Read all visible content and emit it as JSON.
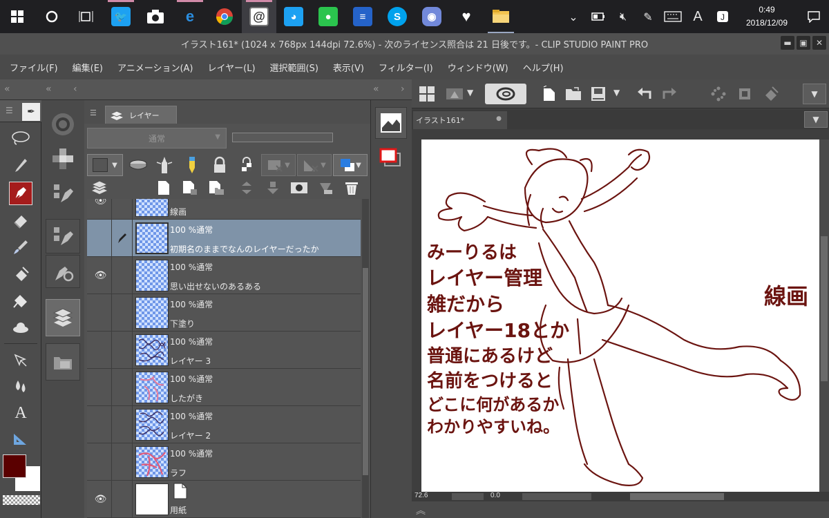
{
  "taskbar": {
    "apps": [
      "start",
      "search-circle",
      "task-view",
      "twitter",
      "camera",
      "edge",
      "chrome",
      "clip-studio",
      "cat-app",
      "line",
      "file-stack",
      "skype",
      "discord",
      "heart-app",
      "file-explorer"
    ],
    "tray": {
      "ime": "A",
      "time": "0:49",
      "date": "2018/12/09"
    }
  },
  "window": {
    "title": "イラスト161* (1024 x 768px 144dpi 72.6%)  - 次のライセンス照合は 21 日後です。- CLIP STUDIO PAINT PRO"
  },
  "menu": [
    "ファイル(F)",
    "編集(E)",
    "アニメーション(A)",
    "レイヤー(L)",
    "選択範囲(S)",
    "表示(V)",
    "フィルター(I)",
    "ウィンドウ(W)",
    "ヘルプ(H)"
  ],
  "layer_panel": {
    "tab_label": "レイヤー",
    "blend_mode": "通常",
    "layers": [
      {
        "name": "線画",
        "blend": "",
        "visible": true,
        "selected": false,
        "thumb": "lines",
        "partial": true
      },
      {
        "name": "初期名のままでなんのレイヤーだったか",
        "blend": "100 %通常",
        "visible": false,
        "selected": true,
        "thumb": "empty",
        "pen": true
      },
      {
        "name": "思い出せないのあるある",
        "blend": "100 %通常",
        "visible": true,
        "selected": false,
        "thumb": "empty"
      },
      {
        "name": "下塗り",
        "blend": "100 %通常",
        "visible": false,
        "selected": false,
        "thumb": "empty"
      },
      {
        "name": "レイヤー 3",
        "blend": "100 %通常",
        "visible": false,
        "selected": false,
        "thumb": "scribble"
      },
      {
        "name": "したがき",
        "blend": "100 %通常",
        "visible": false,
        "selected": false,
        "thumb": "pink"
      },
      {
        "name": "レイヤー 2",
        "blend": "100 %通常",
        "visible": false,
        "selected": false,
        "thumb": "scribble"
      },
      {
        "name": "ラフ",
        "blend": "100 %通常",
        "visible": false,
        "selected": false,
        "thumb": "pink"
      },
      {
        "name": "用紙",
        "blend": "",
        "visible": true,
        "selected": false,
        "thumb": "paper"
      }
    ]
  },
  "canvas": {
    "doc_tab": "イラスト161*",
    "zoom": "72.6",
    "angle": "0.0",
    "handwritten_note": [
      "みーりるは",
      "レイヤー管理",
      "雑だから",
      "レイヤー18とか",
      "普通にあるけど",
      "名前をつけると",
      "どこに何があるか",
      "わかりやすいね。"
    ],
    "handwritten_label": "線画"
  },
  "colors": {
    "main": "#5a0000",
    "sub": "#ffffff",
    "ink": "#6b1410"
  }
}
